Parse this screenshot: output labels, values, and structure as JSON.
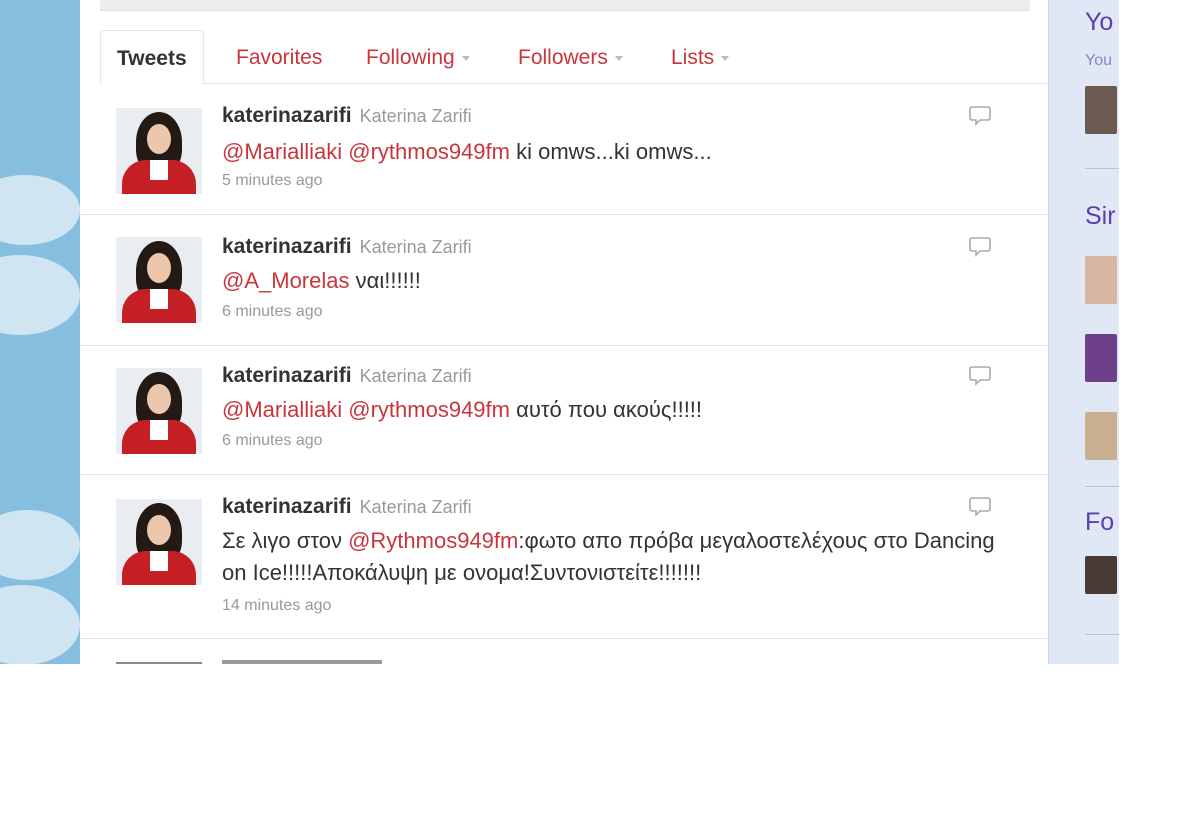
{
  "colors": {
    "mention": "#c8363c",
    "text": "#333333",
    "meta": "#999999",
    "sidebar_heading": "#5a3fb0",
    "background_sky": "#86bedf"
  },
  "tabs": [
    {
      "label": "Tweets",
      "active": true
    },
    {
      "label": "Favorites",
      "active": false
    },
    {
      "label": "Following",
      "active": false,
      "has_caret": true
    },
    {
      "label": "Followers",
      "active": false,
      "has_caret": true
    },
    {
      "label": "Lists",
      "active": false,
      "has_caret": true
    }
  ],
  "tweets": [
    {
      "screen_name": "katerinazarifi",
      "full_name": "Katerina Zarifi",
      "mention1": "@Marialliaki",
      "mention2": "@rythmos949fm",
      "text": "ki omws...ki omws...",
      "time": "5 minutes ago",
      "reply_icon": "reply-icon"
    },
    {
      "screen_name": "katerinazarifi",
      "full_name": "Katerina Zarifi",
      "mention1": "@A_Morelas",
      "text": "ναι!!!!!!",
      "time": "6 minutes ago",
      "reply_icon": "reply-icon"
    },
    {
      "screen_name": "katerinazarifi",
      "full_name": "Katerina Zarifi",
      "mention1": "@Marialliaki",
      "mention2": "@rythmos949fm",
      "text": "αυτό που ακούς!!!!!",
      "time": "6 minutes ago",
      "reply_icon": "reply-icon"
    },
    {
      "screen_name": "katerinazarifi",
      "full_name": "Katerina Zarifi",
      "text_before": "Σε λιγο στον",
      "mention1": "@Rythmos949fm",
      "text": ":φωτο απο πρόβα μεγαλοστελέχους στο Dancing on Ice!!!!!Αποκάλυψη με ονομα!Συντονιστείτε!!!!!!!",
      "time": "14 minutes ago",
      "reply_icon": "reply-icon"
    }
  ],
  "sidebar": {
    "heading1": "Yo",
    "sub1": "You",
    "heading2": "Sir",
    "heading3": "Fo"
  }
}
